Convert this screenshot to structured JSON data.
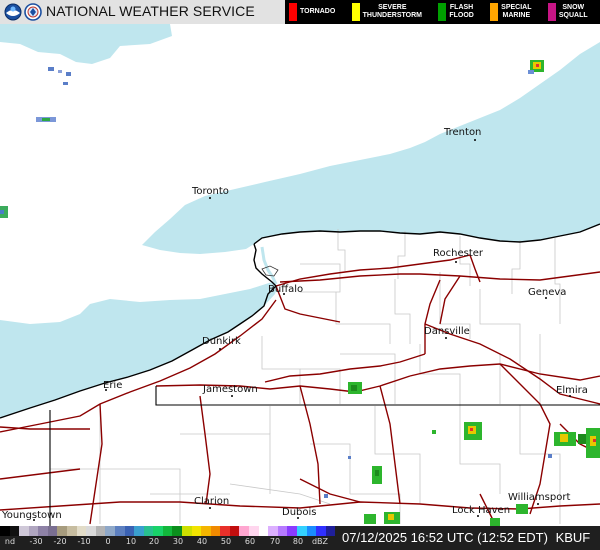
{
  "header": {
    "title": "NATIONAL WEATHER SERVICE",
    "legend": [
      {
        "label": "TORNADO",
        "color": "#ff0000"
      },
      {
        "label": "SEVERE\nTHUNDERSTORM",
        "color": "#ffff00"
      },
      {
        "label": "FLASH\nFLOOD",
        "color": "#00a000"
      },
      {
        "label": "SPECIAL\nMARINE",
        "color": "#ffa500"
      },
      {
        "label": "SNOW\nSQUALL",
        "color": "#c71585"
      }
    ]
  },
  "map": {
    "water_color": "#bfe6ee",
    "land_color": "#ffffff",
    "highway_color": "#8b0000",
    "border_color": "#000000",
    "cities": [
      {
        "name": "Trenton"
      },
      {
        "name": "Toronto"
      },
      {
        "name": "Rochester"
      },
      {
        "name": "Buffalo"
      },
      {
        "name": "Geneva"
      },
      {
        "name": "Dansville"
      },
      {
        "name": "Dunkirk"
      },
      {
        "name": "Erie"
      },
      {
        "name": "Jamestown"
      },
      {
        "name": "Elmira"
      },
      {
        "name": "Clarion"
      },
      {
        "name": "Dubois"
      },
      {
        "name": "Williamsport"
      },
      {
        "name": "Lock Haven"
      },
      {
        "name": "Youngstown"
      }
    ]
  },
  "scale": {
    "labels": [
      "nd",
      "-30",
      "-20",
      "-10",
      "0",
      "10",
      "20",
      "30",
      "40",
      "50",
      "60",
      "70",
      "80",
      "dBZ"
    ]
  },
  "footer": {
    "timestamp": "07/12/2025 16:52 UTC (12:52 EDT)",
    "station": "KBUF"
  }
}
